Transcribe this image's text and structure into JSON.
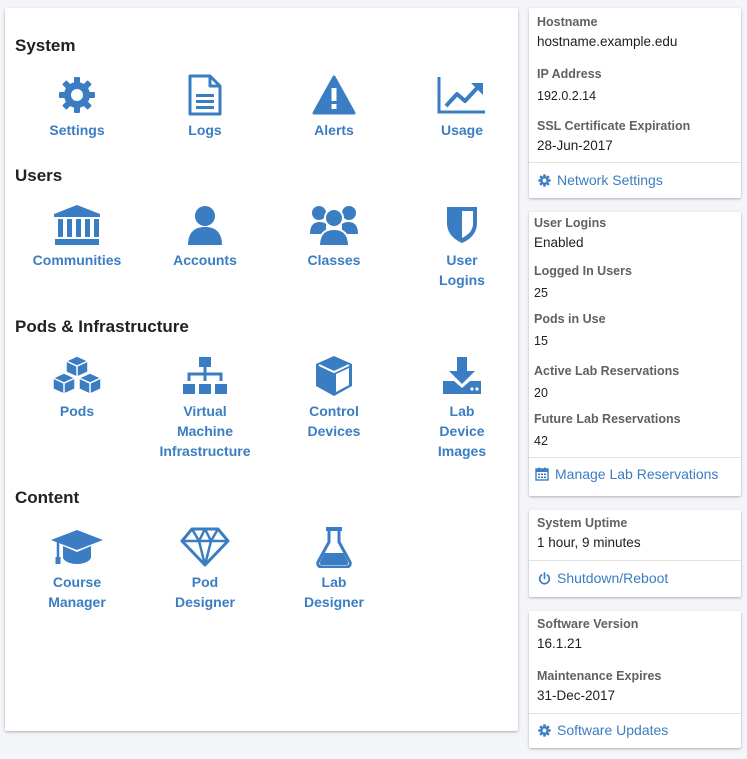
{
  "sections": {
    "system": {
      "title": "System",
      "tiles": [
        {
          "label": "Settings",
          "icon": "gear-icon"
        },
        {
          "label": "Logs",
          "icon": "document-icon"
        },
        {
          "label": "Alerts",
          "icon": "warning-triangle-icon"
        },
        {
          "label": "Usage",
          "icon": "line-chart-icon"
        }
      ]
    },
    "users": {
      "title": "Users",
      "tiles": [
        {
          "label": "Communities",
          "icon": "institution-icon"
        },
        {
          "label": "Accounts",
          "icon": "user-icon"
        },
        {
          "label": "Classes",
          "icon": "users-group-icon"
        },
        {
          "label": "User\nLogins",
          "icon": "shield-icon"
        }
      ]
    },
    "pods": {
      "title": "Pods & Infrastructure",
      "tiles": [
        {
          "label": "Pods",
          "icon": "cubes-icon"
        },
        {
          "label": "Virtual\nMachine\nInfrastructure",
          "icon": "sitemap-icon"
        },
        {
          "label": "Control\nDevices",
          "icon": "cube-icon"
        },
        {
          "label": "Lab\nDevice\nImages",
          "icon": "download-icon"
        }
      ]
    },
    "content": {
      "title": "Content",
      "tiles": [
        {
          "label": "Course\nManager",
          "icon": "graduation-cap-icon"
        },
        {
          "label": "Pod\nDesigner",
          "icon": "diamond-icon"
        },
        {
          "label": "Lab\nDesigner",
          "icon": "flask-icon"
        }
      ]
    }
  },
  "network": {
    "hostname_label": "Hostname",
    "hostname": "hostname.example.edu",
    "ip_label": "IP Address",
    "ip": "192.0.2.14",
    "ssl_label": "SSL Certificate Expiration",
    "ssl": "28-Jun-2017",
    "action": "Network Settings",
    "action_icon": "gear-icon"
  },
  "status": {
    "user_logins_label": "User Logins",
    "user_logins": "Enabled",
    "logged_in_label": "Logged In Users",
    "logged_in": "25",
    "pods_label": "Pods in Use",
    "pods": "15",
    "active_res_label": "Active Lab Reservations",
    "active_res": "20",
    "future_res_label": "Future Lab Reservations",
    "future_res": "42",
    "action": "Manage Lab Reservations",
    "action_icon": "calendar-icon"
  },
  "uptime": {
    "label": "System Uptime",
    "value": "1 hour, 9 minutes",
    "action": "Shutdown/Reboot",
    "action_icon": "power-icon"
  },
  "software": {
    "version_label": "Software Version",
    "version": "16.1.21",
    "maintenance_label": "Maintenance Expires",
    "maintenance": "31-Dec-2017",
    "action": "Software Updates",
    "action_icon": "gear-icon"
  },
  "colors": {
    "accent": "#3b7dc2",
    "background": "#f3f5f8",
    "panel": "#ffffff"
  }
}
